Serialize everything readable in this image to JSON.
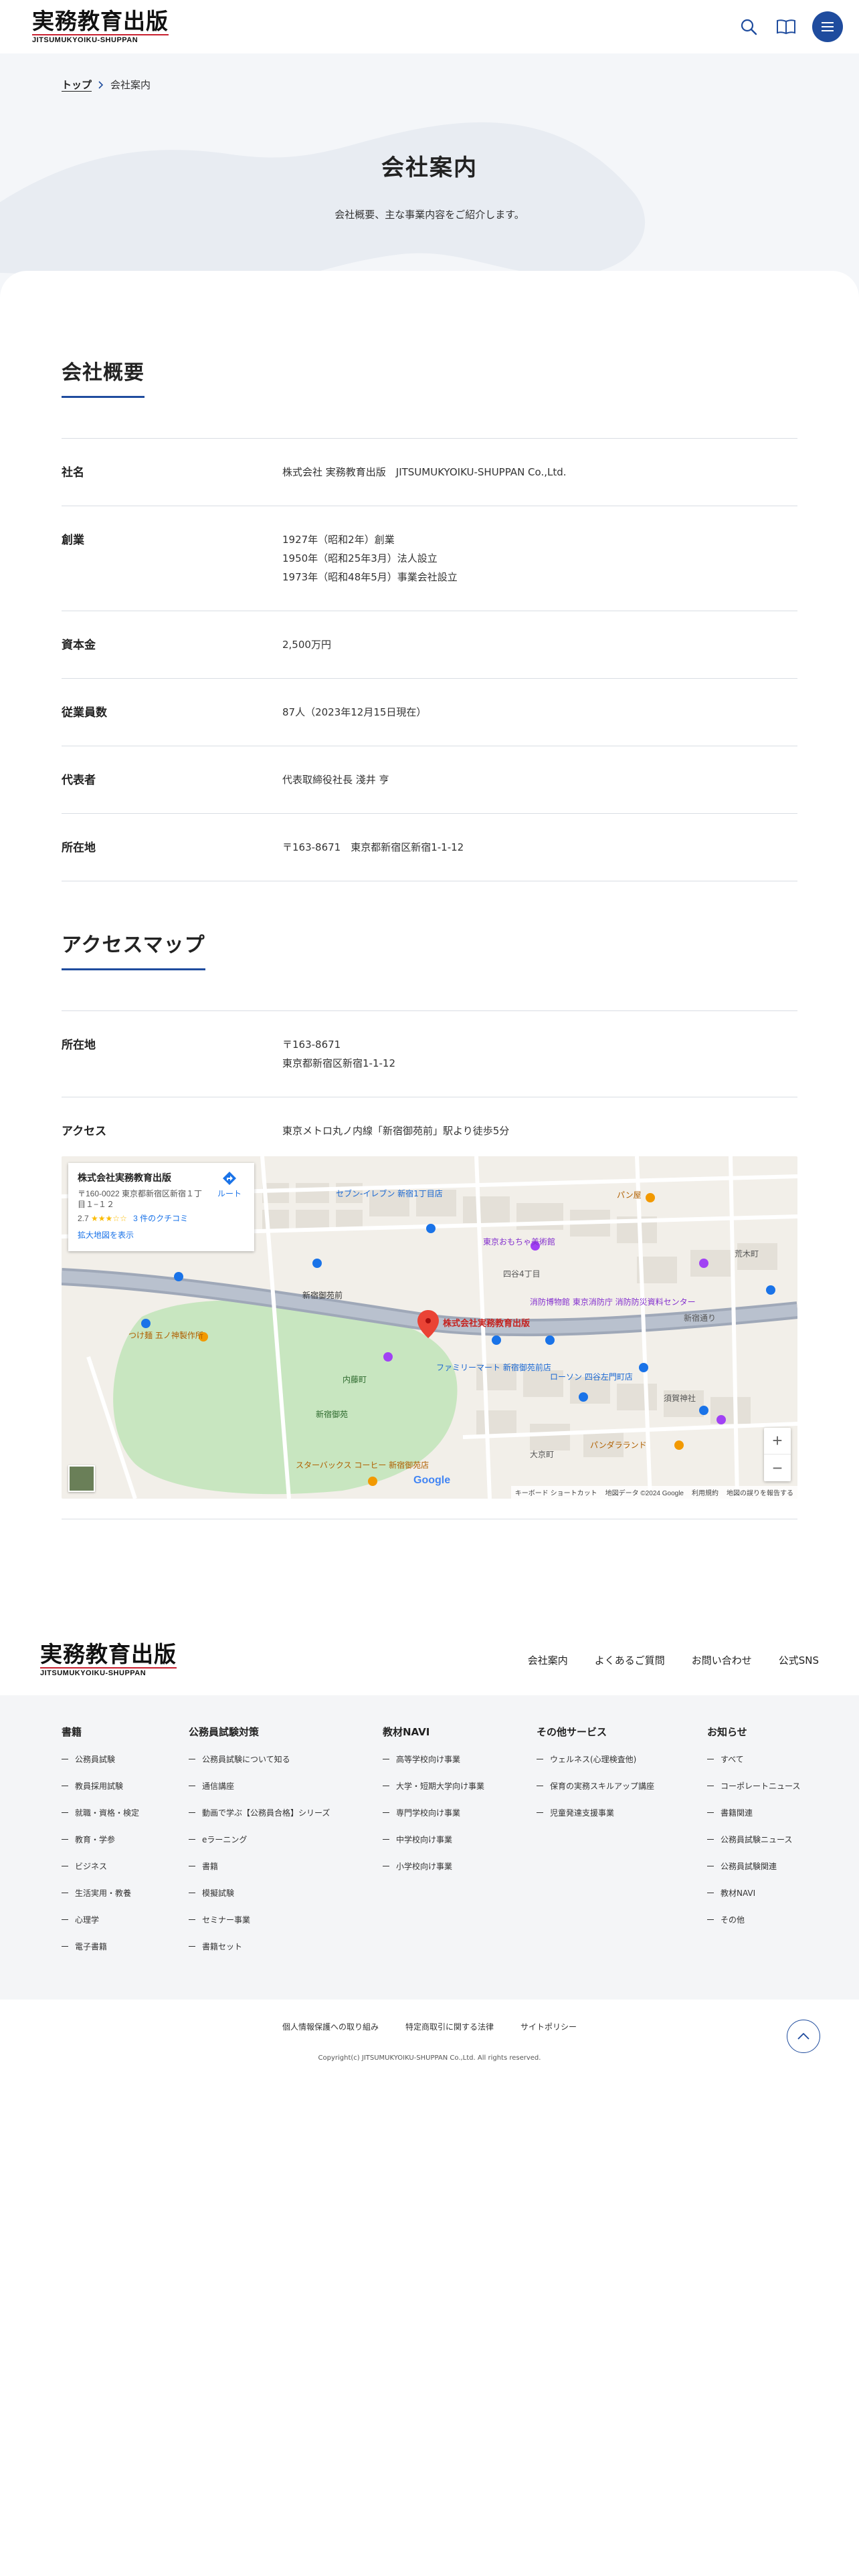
{
  "header": {
    "logo_main": "実務教育出版",
    "logo_sub": "JITSUMUKYOIKU-SHUPPAN",
    "icons": [
      "search-icon",
      "book-icon",
      "menu-icon"
    ]
  },
  "breadcrumb": {
    "home": "トップ",
    "current": "会社案内"
  },
  "hero": {
    "title": "会社案内",
    "lead": "会社概要、主な事業内容をご紹介します。"
  },
  "overview": {
    "title": "会社概要",
    "rows": [
      {
        "label": "社名",
        "lines": [
          "株式会社 実務教育出版　JITSUMUKYOIKU-SHUPPAN Co.,Ltd."
        ]
      },
      {
        "label": "創業",
        "lines": [
          "1927年（昭和2年）創業",
          "1950年（昭和25年3月）法人設立",
          "1973年（昭和48年5月）事業会社設立"
        ]
      },
      {
        "label": "資本金",
        "lines": [
          "2,500万円"
        ]
      },
      {
        "label": "従業員数",
        "lines": [
          "87人（2023年12月15日現在）"
        ]
      },
      {
        "label": "代表者",
        "lines": [
          "代表取締役社長 淺井 亨"
        ]
      },
      {
        "label": "所在地",
        "lines": [
          "〒163-8671　東京都新宿区新宿1-1-12"
        ]
      }
    ]
  },
  "access": {
    "title": "アクセスマップ",
    "rows": [
      {
        "label": "所在地",
        "lines": [
          "〒163-8671",
          "東京都新宿区新宿1-1-12"
        ]
      },
      {
        "label": "アクセス",
        "lines": [
          "東京メトロ丸ノ内線「新宿御苑前」駅より徒歩5分"
        ]
      }
    ]
  },
  "map": {
    "card_name": "株式会社実務教育出版",
    "card_address": "〒160-0022 東京都新宿区新宿１丁目１−１２",
    "rating_value": "2.7",
    "rating_stars": "★★★☆☆",
    "reviews": "3 件のクチコミ",
    "enlarge_link": "拡大地図を表示",
    "route_label": "ルート",
    "pin_label": "株式会社実務教育出版",
    "labels": {
      "gyoen": "新宿御苑",
      "naitoucho": "内藤町",
      "gyoen_mae": "新宿御苑前",
      "ekimae": "新宿御苑前",
      "tsukemen": "つけ麺 五ノ神製作所",
      "starbucks": "スターバックス コーヒー 新宿御苑店",
      "museum": "東京おもちゃ美術館",
      "fire": "消防博物館 東京消防庁 消防防災資料センター",
      "lawson": "ローソン 四谷左門町店",
      "familymart": "ファミリーマート 新宿御苑前店",
      "seven": "セブン-イレブン 新宿1丁目店",
      "panda": "パンダラランド",
      "sugacho": "須賀神社",
      "araki": "荒木町",
      "yotsuya4": "四谷4丁目",
      "shinjuku_dori": "新宿通り",
      "ooki": "大京町",
      "pan": "パン屋"
    },
    "zoom_in": "+",
    "zoom_out": "−",
    "google": "Google",
    "attrib_keyboard": "キーボード ショートカット",
    "attrib_data": "地図データ ©2024 Google",
    "attrib_terms": "利用規約",
    "attrib_report": "地図の誤りを報告する"
  },
  "footer": {
    "logo_main": "実務教育出版",
    "logo_sub": "JITSUMUKYOIKU-SHUPPAN",
    "nav": [
      "会社案内",
      "よくあるご質問",
      "お問い合わせ",
      "公式SNS"
    ],
    "columns": [
      {
        "title": "書籍",
        "items": [
          "公務員試験",
          "教員採用試験",
          "就職・資格・検定",
          "教育・学参",
          "ビジネス",
          "生活実用・教養",
          "心理学",
          "電子書籍"
        ]
      },
      {
        "title": "公務員試験対策",
        "items": [
          "公務員試験について知る",
          "通信講座",
          "動画で学ぶ【公務員合格】シリーズ",
          "eラーニング",
          "書籍",
          "模擬試験",
          "セミナー事業",
          "書籍セット"
        ]
      },
      {
        "title": "教材NAVI",
        "items": [
          "高等学校向け事業",
          "大学・短期大学向け事業",
          "専門学校向け事業",
          "中学校向け事業",
          "小学校向け事業"
        ]
      },
      {
        "title": "その他サービス",
        "items": [
          "ウェルネス(心理検査他)",
          "保育の実務スキルアップ講座",
          "児童発達支援事業"
        ]
      },
      {
        "title": "お知らせ",
        "items": [
          "すべて",
          "コーポレートニュース",
          "書籍関連",
          "公務員試験ニュース",
          "公務員試験関連",
          "教材NAVI",
          "その他"
        ]
      }
    ],
    "policy": [
      "個人情報保護への取り組み",
      "特定商取引に関する法律",
      "サイトポリシー"
    ],
    "copyright": "Copyright(c) JITSUMUKYOIKU-SHUPPAN Co.,Ltd. All rights reserved."
  },
  "colors": {
    "accent": "#1f4c9e",
    "logo_red": "#c8202f",
    "hero_bg": "#f4f6f9",
    "footer_bg": "#f4f5f7"
  }
}
